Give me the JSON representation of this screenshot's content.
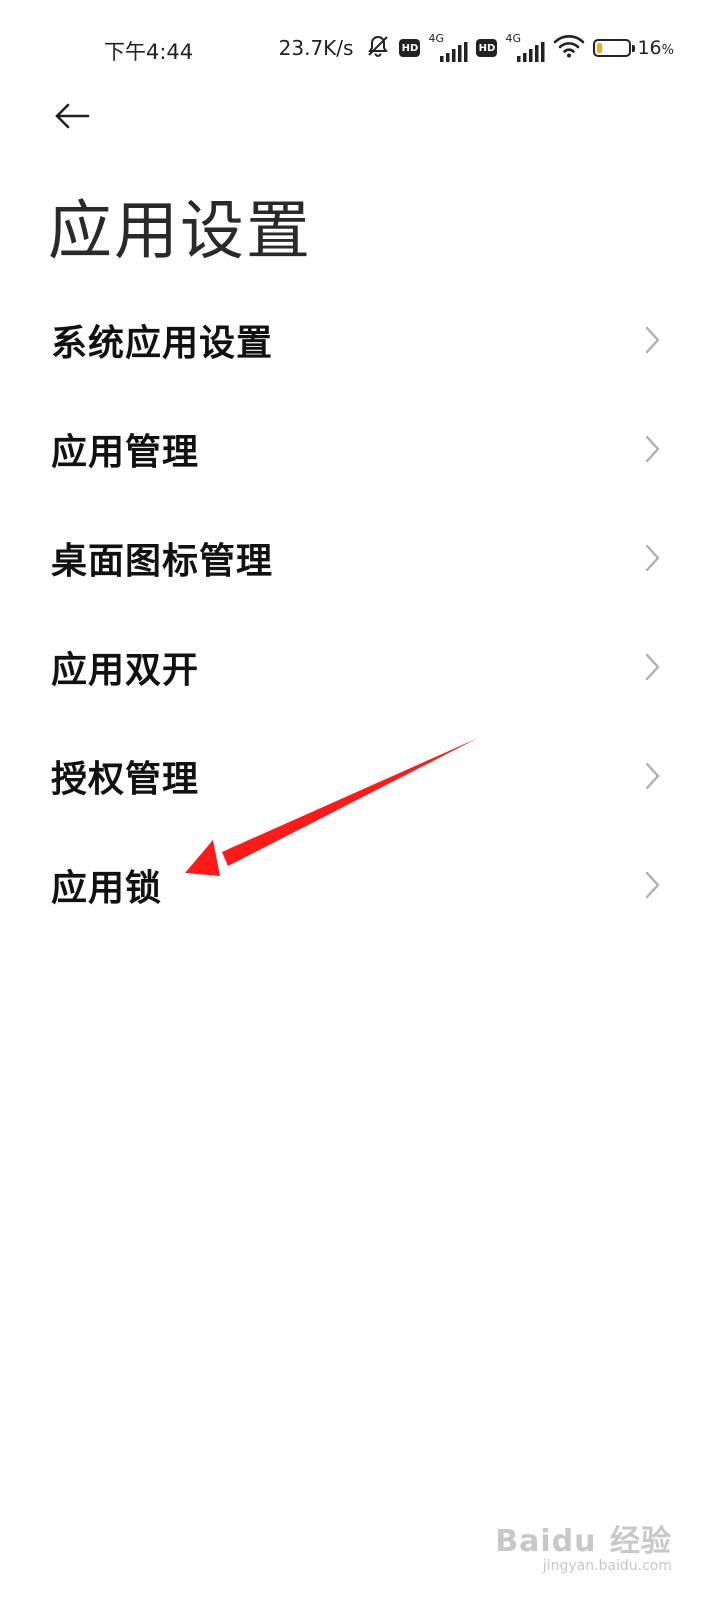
{
  "status_bar": {
    "time": "下午4:44",
    "net_speed": "23.7K/s",
    "hd_label": "HD",
    "network_type": "4G",
    "battery_percent": "16",
    "battery_unit": "%",
    "battery_level": 0.16,
    "battery_color": "#f5a623",
    "icons": [
      "mute-bell-icon",
      "hd-icon",
      "signal-icon",
      "wifi-icon",
      "battery-icon"
    ]
  },
  "header": {
    "back_icon": "arrow-left-icon",
    "title": "应用设置"
  },
  "settings": {
    "items": [
      {
        "label": "系统应用设置"
      },
      {
        "label": "应用管理"
      },
      {
        "label": "桌面图标管理"
      },
      {
        "label": "应用双开"
      },
      {
        "label": "授权管理"
      },
      {
        "label": "应用锁"
      }
    ]
  },
  "annotation": {
    "color": "#ff1a1a"
  },
  "watermark": {
    "brand": "Bai",
    "brand_mid": "du",
    "brand_cn": "经验",
    "domain": "jingyan.baidu.com"
  }
}
